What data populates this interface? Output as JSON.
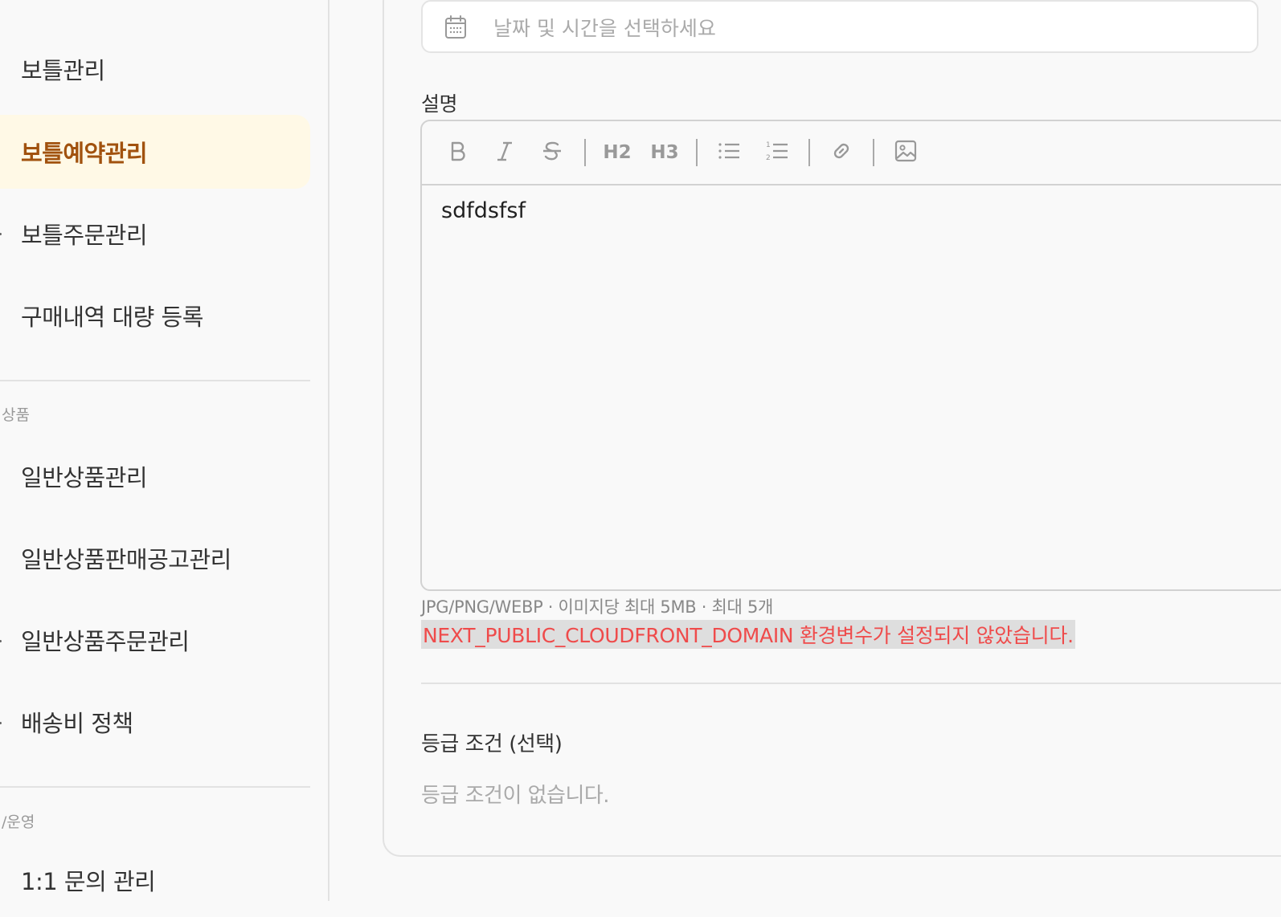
{
  "sidebar": {
    "items_top": [
      {
        "label": "보틀관리",
        "active": false
      },
      {
        "label": "보틀예약관리",
        "active": true
      },
      {
        "label": "보틀주문관리",
        "active": false
      },
      {
        "label": "구매내역 대량 등록",
        "active": false
      }
    ],
    "section_products": "상품",
    "items_products": [
      {
        "label": "일반상품관리"
      },
      {
        "label": "일반상품판매공고관리"
      },
      {
        "label": "일반상품주문관리"
      },
      {
        "label": "배송비 정책"
      }
    ],
    "section_ops": "/운영",
    "items_ops": [
      {
        "label": "1:1 문의 관리"
      }
    ],
    "active_color": "#a1520e",
    "active_bg": "#fff9e6"
  },
  "form": {
    "datetime": {
      "placeholder": "날짜 및 시간을 선택하세요",
      "icon": "calendar-icon"
    },
    "description": {
      "label": "설명",
      "content": "sdfdsfsf",
      "toolbar": {
        "bold_icon": "bold-icon",
        "italic_icon": "italic-icon",
        "strike_icon": "strikethrough-icon",
        "h2_label": "H2",
        "h3_label": "H3",
        "bullet_icon": "bullet-list-icon",
        "ordered_icon": "ordered-list-icon",
        "link_icon": "link-icon",
        "image_icon": "image-icon"
      },
      "help": "JPG/PNG/WEBP · 이미지당 최대 5MB · 최대 5개",
      "error": "NEXT_PUBLIC_CLOUDFRONT_DOMAIN 환경변수가 설정되지 않았습니다.",
      "error_color": "#ef4b4b"
    },
    "grade": {
      "label": "등급 조건 (선택)",
      "empty": "등급 조건이 없습니다."
    }
  }
}
